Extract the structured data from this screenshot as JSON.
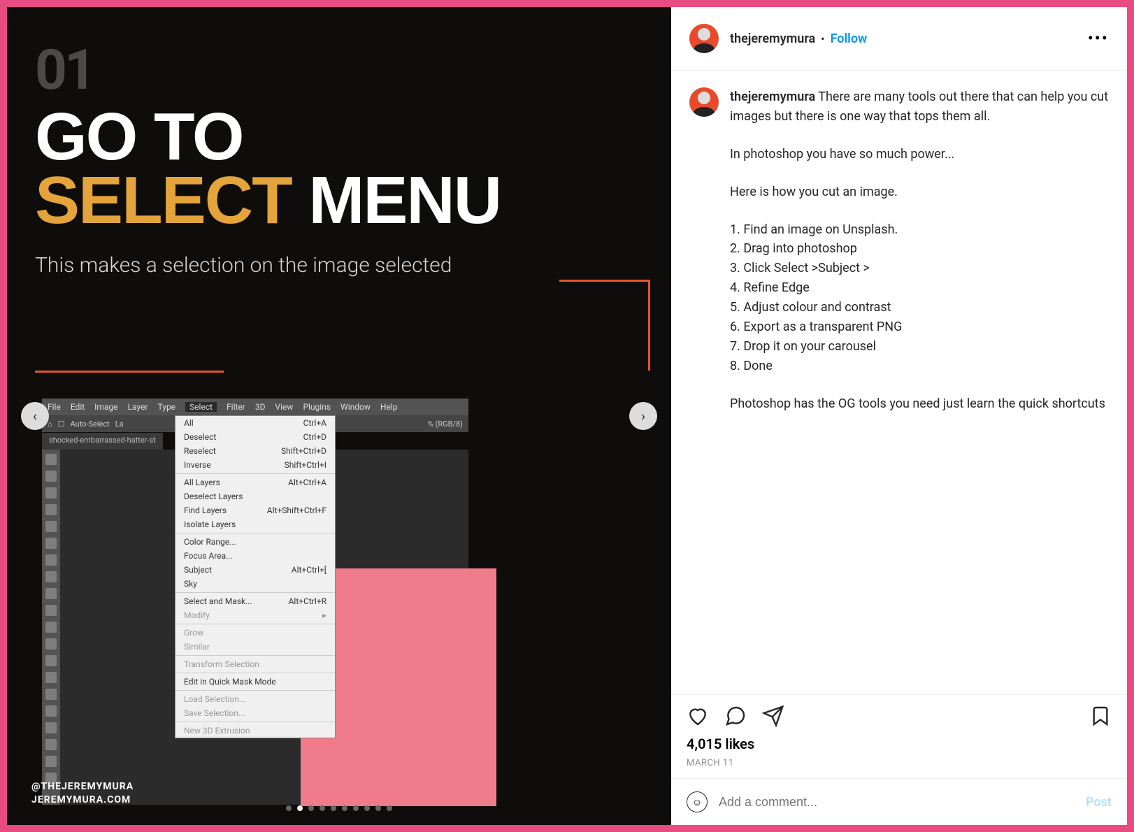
{
  "slide": {
    "number": "01",
    "title_line1_a": "GO TO",
    "title_line2_a": "SELECT",
    "title_line2_b": "MENU",
    "subtitle": "This makes a selection on the image selected",
    "handle": "@THEJEREMYMURA",
    "site": "JEREMYMURA.COM",
    "ps_menubar": [
      "File",
      "Edit",
      "Image",
      "Layer",
      "Type",
      "Select",
      "Filter",
      "3D",
      "View",
      "Plugins",
      "Window",
      "Help"
    ],
    "ps_tab": "shocked-embarrassed-hatter-st",
    "ps_opts": [
      "Auto-Select",
      "La"
    ],
    "ps_info": "% (RGB/8)",
    "select_menu": [
      {
        "l": "All",
        "s": "Ctrl+A"
      },
      {
        "l": "Deselect",
        "s": "Ctrl+D"
      },
      {
        "l": "Reselect",
        "s": "Shift+Ctrl+D"
      },
      {
        "l": "Inverse",
        "s": "Shift+Ctrl+I"
      },
      {
        "sep": true
      },
      {
        "l": "All Layers",
        "s": "Alt+Ctrl+A"
      },
      {
        "l": "Deselect Layers",
        "s": ""
      },
      {
        "l": "Find Layers",
        "s": "Alt+Shift+Ctrl+F"
      },
      {
        "l": "Isolate Layers",
        "s": ""
      },
      {
        "sep": true
      },
      {
        "l": "Color Range...",
        "s": ""
      },
      {
        "l": "Focus Area...",
        "s": ""
      },
      {
        "l": "Subject",
        "s": "Alt+Ctrl+["
      },
      {
        "l": "Sky",
        "s": ""
      },
      {
        "sep": true
      },
      {
        "l": "Select and Mask...",
        "s": "Alt+Ctrl+R"
      },
      {
        "l": "Modify",
        "s": "▸",
        "dis": true
      },
      {
        "sep": true
      },
      {
        "l": "Grow",
        "s": "",
        "dis": true
      },
      {
        "l": "Similar",
        "s": "",
        "dis": true
      },
      {
        "sep": true
      },
      {
        "l": "Transform Selection",
        "s": "",
        "dis": true
      },
      {
        "sep": true
      },
      {
        "l": "Edit in Quick Mask Mode",
        "s": ""
      },
      {
        "sep": true
      },
      {
        "l": "Load Selection...",
        "s": "",
        "dis": true
      },
      {
        "l": "Save Selection...",
        "s": "",
        "dis": true
      },
      {
        "sep": true
      },
      {
        "l": "New 3D Extrusion",
        "s": "",
        "dis": true
      }
    ],
    "active_dot": 1,
    "total_dots": 10
  },
  "post": {
    "username": "thejeremymura",
    "follow": "Follow",
    "caption_paras": [
      "There are many tools out there that can help you cut images but there is one way that tops them all.",
      "In photoshop you have so much power...",
      "Here is how you cut an image.",
      "1. Find an image on Unsplash.\n2. Drag into photoshop\n3. Click Select >Subject >\n4. Refine Edge\n5. Adjust colour and contrast\n6. Export as a transparent PNG\n7. Drop it on your carousel\n8. Done",
      "Photoshop has the OG tools you need just learn the quick shortcuts"
    ],
    "likes": "4,015 likes",
    "date": "MARCH 11",
    "comment_placeholder": "Add a comment...",
    "post_btn": "Post"
  }
}
